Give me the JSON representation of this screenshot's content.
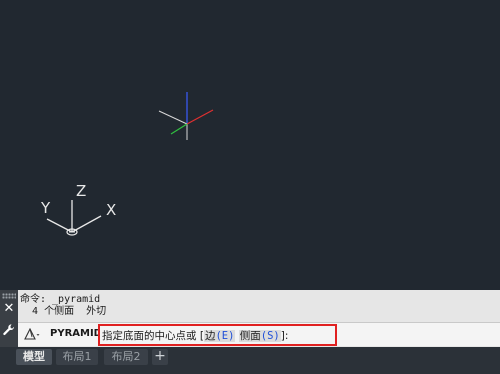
{
  "canvas": {
    "ucs_labels": {
      "x": "X",
      "y": "Y",
      "z": "Z"
    }
  },
  "command_panel": {
    "history": [
      "命令: _pyramid",
      "  4 个侧面  外切"
    ],
    "command_name": "PYRAMID",
    "prompt": {
      "text": "指定底面的中心点或",
      "bracket_open": " [",
      "option1_label": "边",
      "option1_key": "(E)",
      "option2_label": "侧面",
      "option2_key": "(S)",
      "bracket_close": "]:"
    },
    "icons": [
      "close-icon",
      "wrench-icon",
      "pyramid-icon",
      "chevron-down-icon"
    ]
  },
  "tabs": [
    {
      "label": "模型",
      "active": true
    },
    {
      "label": "布局1",
      "active": false
    },
    {
      "label": "布局2",
      "active": false
    }
  ],
  "tab_add_label": "+",
  "colors": {
    "background": "#212830",
    "highlight_border": "#e02020",
    "option_key": "#1f4fd8"
  }
}
